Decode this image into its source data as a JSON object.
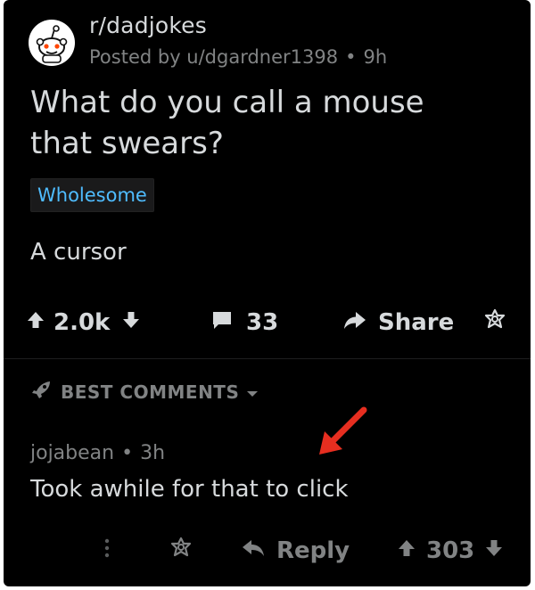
{
  "post": {
    "subreddit": "r/dadjokes",
    "posted_by": "Posted by u/dgardner1398",
    "meta_sep": "•",
    "age": "9h",
    "title": "What do you call a mouse that swears?",
    "flair": "Wholesome",
    "body": "A cursor"
  },
  "actions": {
    "score": "2.0k",
    "comments": "33",
    "share": "Share"
  },
  "sort": {
    "label": "BEST COMMENTS"
  },
  "comment": {
    "author": "jojabean",
    "sep": "•",
    "age": "3h",
    "text": "Took awhile for that to click",
    "reply": "Reply",
    "score": "303"
  },
  "colors": {
    "background": "#000000",
    "text": "#d7dadc",
    "muted": "#818384",
    "flair": "#4fbcff",
    "annotation_arrow": "#e62e20"
  },
  "icons": [
    "snoo-avatar-icon",
    "upvote-icon",
    "downvote-icon",
    "comment-icon",
    "share-arrow-icon",
    "award-icon",
    "rocket-icon",
    "chevron-down-icon",
    "more-vertical-icon",
    "reply-arrow-icon",
    "red-pointer-arrow-icon"
  ]
}
